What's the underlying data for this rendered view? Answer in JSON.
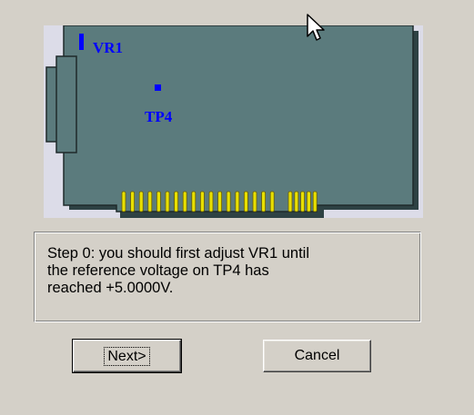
{
  "board": {
    "vr1_label": "VR1",
    "tp4_label": "TP4",
    "trace_color": "#0000ff",
    "board_color": "#5b7b7d",
    "finger_color": "#e8e000"
  },
  "message": {
    "text": "Step 0:  you should first adjust VR1 until\nthe reference voltage on TP4 has\nreached +5.0000V."
  },
  "buttons": {
    "next_label": "Next>",
    "cancel_label": "Cancel"
  },
  "cursor": {
    "icon": "arrow-pointer-icon"
  }
}
